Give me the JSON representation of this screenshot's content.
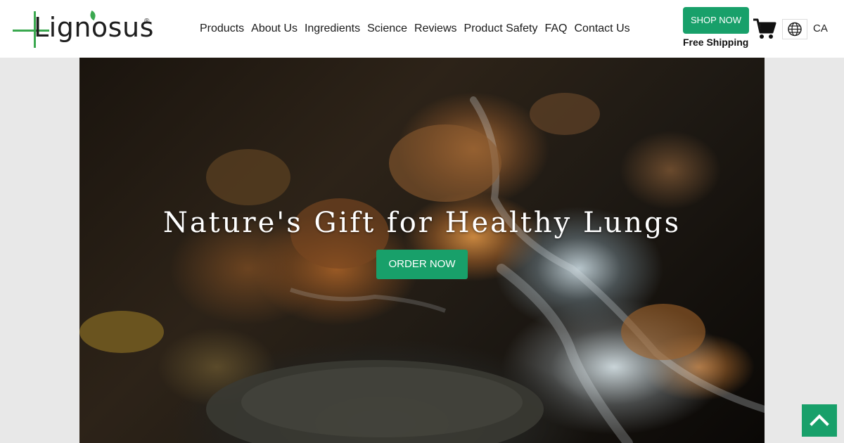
{
  "brand": {
    "name": "Lignosus",
    "registered_mark": "®",
    "accent_color": "#3aa84f"
  },
  "nav": {
    "items": [
      {
        "label": "Products"
      },
      {
        "label": "About Us"
      },
      {
        "label": "Ingredients"
      },
      {
        "label": "Science"
      },
      {
        "label": "Reviews"
      },
      {
        "label": "Product Safety"
      },
      {
        "label": "FAQ"
      },
      {
        "label": "Contact Us"
      }
    ]
  },
  "header_actions": {
    "shop_button": "SHOP NOW",
    "free_shipping": "Free Shipping",
    "cart_icon": "cart-icon",
    "globe_icon": "globe-icon",
    "language": "CA",
    "button_color": "#18a06a"
  },
  "hero": {
    "title": "Nature's Gift for Healthy Lungs",
    "cta": "ORDER NOW"
  },
  "back_to_top": {
    "icon": "chevron-up-icon"
  }
}
